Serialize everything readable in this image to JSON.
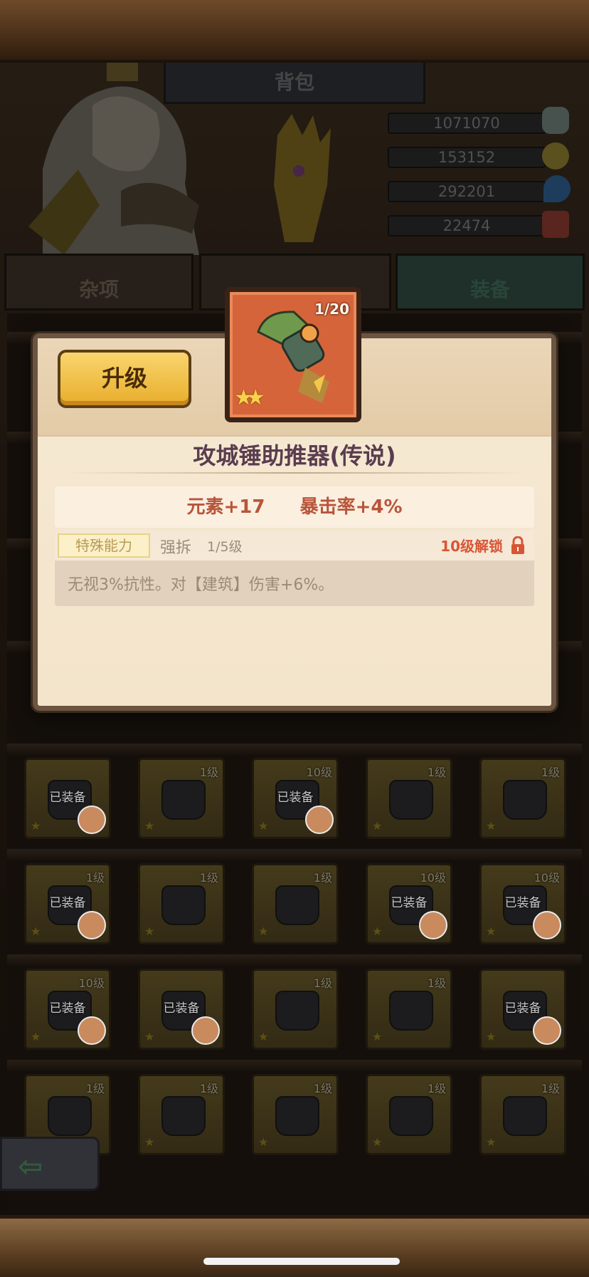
{
  "header": {
    "title": "背包"
  },
  "currencies": [
    {
      "value": "1071070",
      "icon": "ore-icon",
      "color": "#9bb3ae"
    },
    {
      "value": "153152",
      "icon": "coin-icon",
      "color": "#c9b34a"
    },
    {
      "value": "292201",
      "icon": "water-drop-icon",
      "color": "#3f8fd6"
    },
    {
      "value": "22474",
      "icon": "ruby-icon",
      "color": "#c44a3a"
    }
  ],
  "tabs": [
    {
      "label": "杂项"
    },
    {
      "label": ""
    },
    {
      "label": "装备"
    }
  ],
  "modal": {
    "upgrade_label": "升级",
    "item": {
      "count": "1/20",
      "stars": "★★",
      "name": "攻城锤助推器(传说)"
    },
    "stats": [
      {
        "text": "元素+17"
      },
      {
        "text": "暴击率+4%"
      }
    ],
    "ability": {
      "tag": "特殊能力",
      "name": "强拆",
      "level": "1/5级",
      "unlock": "10级解锁",
      "description": "无视3%抗性。对【建筑】伤害+6%。"
    }
  },
  "grid": {
    "rows": [
      [
        {
          "level": "",
          "equipped": "已装备",
          "has_face": true
        },
        {
          "level": "1级",
          "equipped": "",
          "has_face": false
        },
        {
          "level": "10级",
          "equipped": "已装备",
          "has_face": true
        },
        {
          "level": "1级",
          "equipped": "",
          "has_face": false
        },
        {
          "level": "1级",
          "equipped": "",
          "has_face": false
        }
      ],
      [
        {
          "level": "1级",
          "equipped": "已装备",
          "has_face": true
        },
        {
          "level": "1级",
          "equipped": "",
          "has_face": false
        },
        {
          "level": "1级",
          "equipped": "",
          "has_face": false
        },
        {
          "level": "10级",
          "equipped": "已装备",
          "has_face": true
        },
        {
          "level": "10级",
          "equipped": "已装备",
          "has_face": true
        }
      ],
      [
        {
          "level": "10级",
          "equipped": "已装备",
          "has_face": true
        },
        {
          "level": "",
          "equipped": "已装备",
          "has_face": true
        },
        {
          "level": "1级",
          "equipped": "",
          "has_face": false
        },
        {
          "level": "1级",
          "equipped": "",
          "has_face": false
        },
        {
          "level": "",
          "equipped": "已装备",
          "has_face": true
        }
      ],
      [
        {
          "level": "1级",
          "equipped": "",
          "has_face": false
        },
        {
          "level": "1级",
          "equipped": "",
          "has_face": false
        },
        {
          "level": "1级",
          "equipped": "",
          "has_face": false
        },
        {
          "level": "1级",
          "equipped": "",
          "has_face": false
        },
        {
          "level": "1级",
          "equipped": "",
          "has_face": false
        }
      ]
    ],
    "slot_star": "★"
  }
}
